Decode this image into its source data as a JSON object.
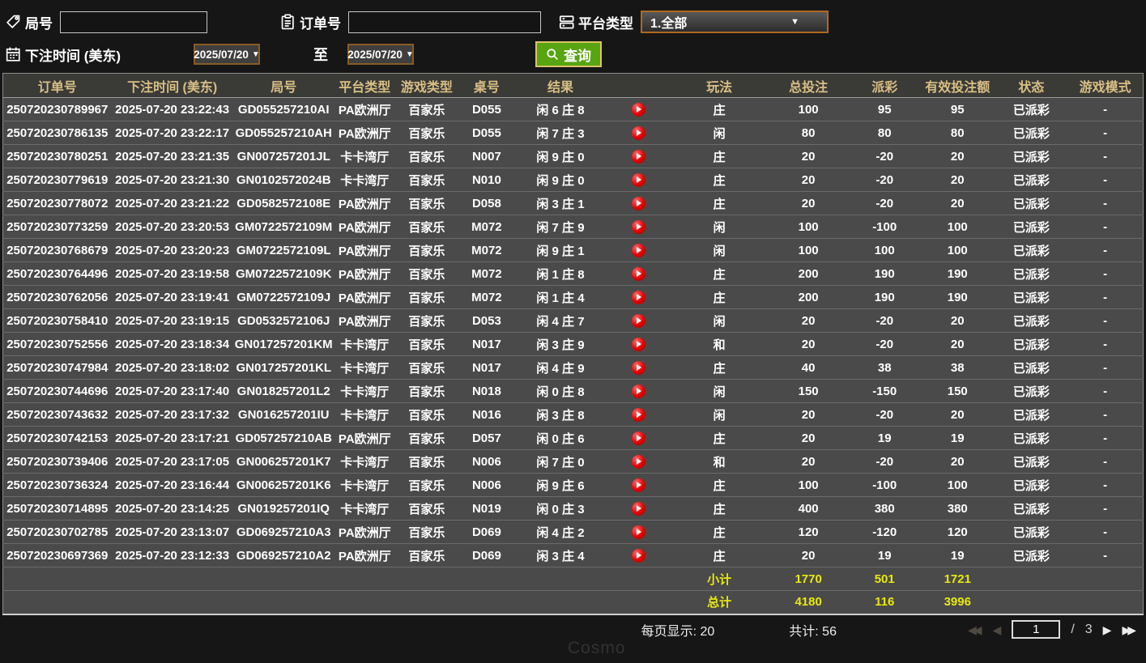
{
  "filters": {
    "round_label": "局号",
    "round_value": "",
    "order_label": "订单号",
    "order_value": "",
    "platform_label": "平台类型",
    "platform_value": "1.全部",
    "bet_time_label": "下注时间 (美东)",
    "date_from": "2025/07/20",
    "to_label": "至",
    "date_to": "2025/07/20",
    "search_label": "查询"
  },
  "table": {
    "headers": [
      "订单号",
      "下注时间 (美东)",
      "局号",
      "平台类型",
      "游戏类型",
      "桌号",
      "结果",
      "",
      "玩法",
      "总投注",
      "派彩",
      "有效投注额",
      "状态",
      "游戏模式"
    ],
    "rows": [
      [
        "250720230789967",
        "2025-07-20 23:22:43",
        "GD055257210AI",
        "PA欧洲厅",
        "百家乐",
        "D055",
        "闲 6 庄 8",
        "庄",
        100,
        95,
        95,
        "已派彩",
        "-"
      ],
      [
        "250720230786135",
        "2025-07-20 23:22:17",
        "GD055257210AH",
        "PA欧洲厅",
        "百家乐",
        "D055",
        "闲 7 庄 3",
        "闲",
        80,
        80,
        80,
        "已派彩",
        "-"
      ],
      [
        "250720230780251",
        "2025-07-20 23:21:35",
        "GN007257201JL",
        "卡卡湾厅",
        "百家乐",
        "N007",
        "闲 9 庄 0",
        "庄",
        20,
        -20,
        20,
        "已派彩",
        "-"
      ],
      [
        "250720230779619",
        "2025-07-20 23:21:30",
        "GN0102572024B",
        "卡卡湾厅",
        "百家乐",
        "N010",
        "闲 9 庄 0",
        "庄",
        20,
        -20,
        20,
        "已派彩",
        "-"
      ],
      [
        "250720230778072",
        "2025-07-20 23:21:22",
        "GD0582572108E",
        "PA欧洲厅",
        "百家乐",
        "D058",
        "闲 3 庄 1",
        "庄",
        20,
        -20,
        20,
        "已派彩",
        "-"
      ],
      [
        "250720230773259",
        "2025-07-20 23:20:53",
        "GM0722572109M",
        "PA欧洲厅",
        "百家乐",
        "M072",
        "闲 7 庄 9",
        "闲",
        100,
        -100,
        100,
        "已派彩",
        "-"
      ],
      [
        "250720230768679",
        "2025-07-20 23:20:23",
        "GM0722572109L",
        "PA欧洲厅",
        "百家乐",
        "M072",
        "闲 9 庄 1",
        "闲",
        100,
        100,
        100,
        "已派彩",
        "-"
      ],
      [
        "250720230764496",
        "2025-07-20 23:19:58",
        "GM0722572109K",
        "PA欧洲厅",
        "百家乐",
        "M072",
        "闲 1 庄 8",
        "庄",
        200,
        190,
        190,
        "已派彩",
        "-"
      ],
      [
        "250720230762056",
        "2025-07-20 23:19:41",
        "GM0722572109J",
        "PA欧洲厅",
        "百家乐",
        "M072",
        "闲 1 庄 4",
        "庄",
        200,
        190,
        190,
        "已派彩",
        "-"
      ],
      [
        "250720230758410",
        "2025-07-20 23:19:15",
        "GD0532572106J",
        "PA欧洲厅",
        "百家乐",
        "D053",
        "闲 4 庄 7",
        "闲",
        20,
        -20,
        20,
        "已派彩",
        "-"
      ],
      [
        "250720230752556",
        "2025-07-20 23:18:34",
        "GN017257201KM",
        "卡卡湾厅",
        "百家乐",
        "N017",
        "闲 3 庄 9",
        "和",
        20,
        -20,
        20,
        "已派彩",
        "-"
      ],
      [
        "250720230747984",
        "2025-07-20 23:18:02",
        "GN017257201KL",
        "卡卡湾厅",
        "百家乐",
        "N017",
        "闲 4 庄 9",
        "庄",
        40,
        38,
        38,
        "已派彩",
        "-"
      ],
      [
        "250720230744696",
        "2025-07-20 23:17:40",
        "GN018257201L2",
        "卡卡湾厅",
        "百家乐",
        "N018",
        "闲 0 庄 8",
        "闲",
        150,
        -150,
        150,
        "已派彩",
        "-"
      ],
      [
        "250720230743632",
        "2025-07-20 23:17:32",
        "GN016257201IU",
        "卡卡湾厅",
        "百家乐",
        "N016",
        "闲 3 庄 8",
        "闲",
        20,
        -20,
        20,
        "已派彩",
        "-"
      ],
      [
        "250720230742153",
        "2025-07-20 23:17:21",
        "GD057257210AB",
        "PA欧洲厅",
        "百家乐",
        "D057",
        "闲 0 庄 6",
        "庄",
        20,
        19,
        19,
        "已派彩",
        "-"
      ],
      [
        "250720230739406",
        "2025-07-20 23:17:05",
        "GN006257201K7",
        "卡卡湾厅",
        "百家乐",
        "N006",
        "闲 7 庄 0",
        "和",
        20,
        -20,
        20,
        "已派彩",
        "-"
      ],
      [
        "250720230736324",
        "2025-07-20 23:16:44",
        "GN006257201K6",
        "卡卡湾厅",
        "百家乐",
        "N006",
        "闲 9 庄 6",
        "庄",
        100,
        -100,
        100,
        "已派彩",
        "-"
      ],
      [
        "250720230714895",
        "2025-07-20 23:14:25",
        "GN019257201IQ",
        "卡卡湾厅",
        "百家乐",
        "N019",
        "闲 0 庄 3",
        "庄",
        400,
        380,
        380,
        "已派彩",
        "-"
      ],
      [
        "250720230702785",
        "2025-07-20 23:13:07",
        "GD069257210A3",
        "PA欧洲厅",
        "百家乐",
        "D069",
        "闲 4 庄 2",
        "庄",
        120,
        -120,
        120,
        "已派彩",
        "-"
      ],
      [
        "250720230697369",
        "2025-07-20 23:12:33",
        "GD069257210A2",
        "PA欧洲厅",
        "百家乐",
        "D069",
        "闲 3 庄 4",
        "庄",
        20,
        19,
        19,
        "已派彩",
        "-"
      ]
    ],
    "subtotal": {
      "label": "小计",
      "total_bet": "1770",
      "payout": "501",
      "valid_bet": "1721"
    },
    "grand_total": {
      "label": "总计",
      "total_bet": "4180",
      "payout": "116",
      "valid_bet": "3996"
    }
  },
  "footer": {
    "per_page": "每页显示: 20",
    "total_count": "共计: 56",
    "current_page": "1",
    "page_sep": "/",
    "total_pages": "3"
  },
  "watermark": "Cosmo",
  "colors": {
    "search_button_green": "#58a411",
    "header_text_gold": "#d9bf85",
    "payout_positive_red": "#c9142e",
    "payout_negative_green": "#3fdd27",
    "status_paid_green": "#2fd42f",
    "totals_yellow": "#e8e812",
    "date_border_brown": "#8a5a26",
    "platform_border_orange": "#b0691f",
    "play_icon_red": "#e00000"
  }
}
